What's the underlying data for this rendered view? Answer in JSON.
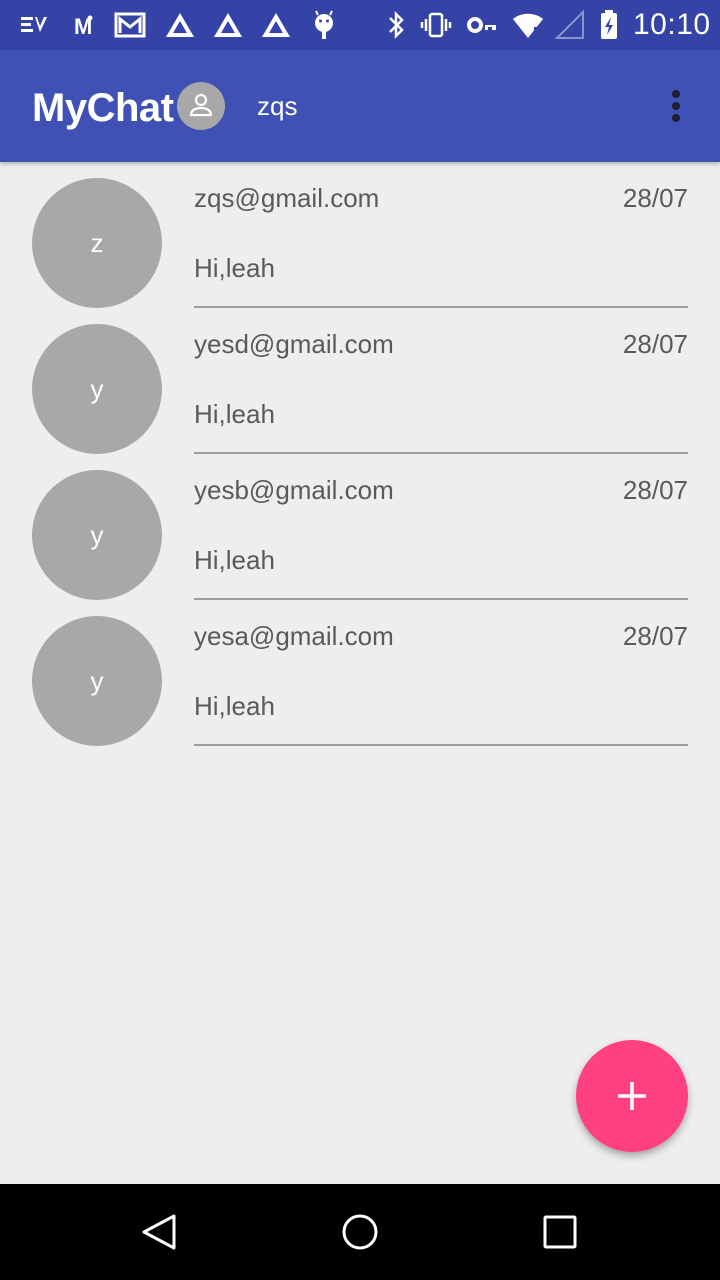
{
  "status_bar": {
    "time": "10:10",
    "icons": [
      "ev-icon",
      "m-icon",
      "gmail-icon",
      "tri-icon",
      "tri-icon",
      "tri-icon",
      "android-icon",
      "bluetooth-icon",
      "vibrate-icon",
      "key-icon",
      "wifi-icon",
      "signal-icon",
      "battery-icon"
    ]
  },
  "app_bar": {
    "title": "MyChat",
    "user_name": "zqs",
    "avatar_icon": "person-icon",
    "menu_icon": "more-vert-icon"
  },
  "conversations": [
    {
      "initial": "z",
      "email": "zqs@gmail.com",
      "date": "28/07",
      "message": "Hi,leah"
    },
    {
      "initial": "y",
      "email": "yesd@gmail.com",
      "date": "28/07",
      "message": "Hi,leah"
    },
    {
      "initial": "y",
      "email": "yesb@gmail.com",
      "date": "28/07",
      "message": "Hi,leah"
    },
    {
      "initial": "y",
      "email": "yesa@gmail.com",
      "date": "28/07",
      "message": "Hi,leah"
    }
  ],
  "fab": {
    "icon": "add-icon"
  },
  "nav_bar": {
    "icons": [
      "back-icon",
      "home-icon",
      "recents-icon"
    ]
  },
  "colors": {
    "primary": "#3f51b5",
    "primary_dark": "#3443a5",
    "accent": "#ff4081",
    "avatar_bg": "#a8a8a8",
    "background": "#eeeeee"
  }
}
